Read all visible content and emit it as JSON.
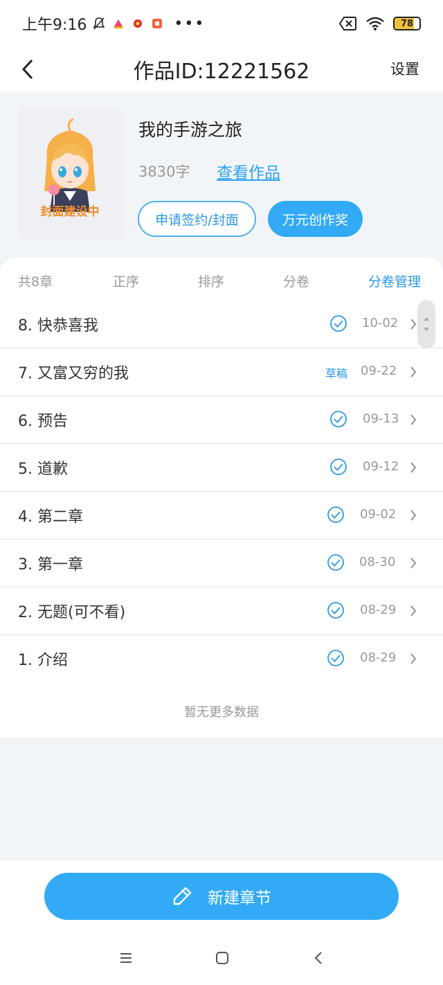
{
  "status_bar": {
    "time": "上午9:16",
    "battery": "78",
    "battery_level": 0.78,
    "more_glyph": "•••",
    "icons": [
      "mute-bell-icon",
      "app-notif-icon",
      "sale-notif-icon",
      "shop-notif-icon",
      "sim-off-icon",
      "wifi-icon"
    ]
  },
  "header": {
    "title": "作品ID:12221562",
    "settings_label": "设置"
  },
  "work": {
    "title": "我的手游之旅",
    "word_count": "3830字",
    "view_link": "查看作品",
    "cover_label": "封面建设中",
    "apply_button": "申请签约/封面",
    "award_button": "万元创作奖"
  },
  "toolbar": {
    "count": "共8章",
    "order": "正序",
    "sort": "排序",
    "volume": "分卷",
    "manage": "分卷管理"
  },
  "chapters": [
    {
      "title": "8. 快恭喜我",
      "status": "published",
      "date": "10-02"
    },
    {
      "title": "7. 又富又穷的我",
      "status": "draft",
      "status_label": "草稿",
      "date": "09-22"
    },
    {
      "title": "6. 预告",
      "status": "published",
      "date": "09-13"
    },
    {
      "title": "5. 道歉",
      "status": "published",
      "date": "09-12"
    },
    {
      "title": "4. 第二章",
      "status": "published",
      "date": "09-02"
    },
    {
      "title": "3. 第一章",
      "status": "published",
      "date": "08-30"
    },
    {
      "title": "2. 无题(可不看)",
      "status": "published",
      "date": "08-29"
    },
    {
      "title": "1. 介绍",
      "status": "published",
      "date": "08-29"
    }
  ],
  "list_footer": "暂无更多数据",
  "new_chapter_button": "新建章节",
  "colors": {
    "accent": "#33aaf5",
    "link": "#2ea3f2",
    "cover_label": "#f08c2a"
  }
}
